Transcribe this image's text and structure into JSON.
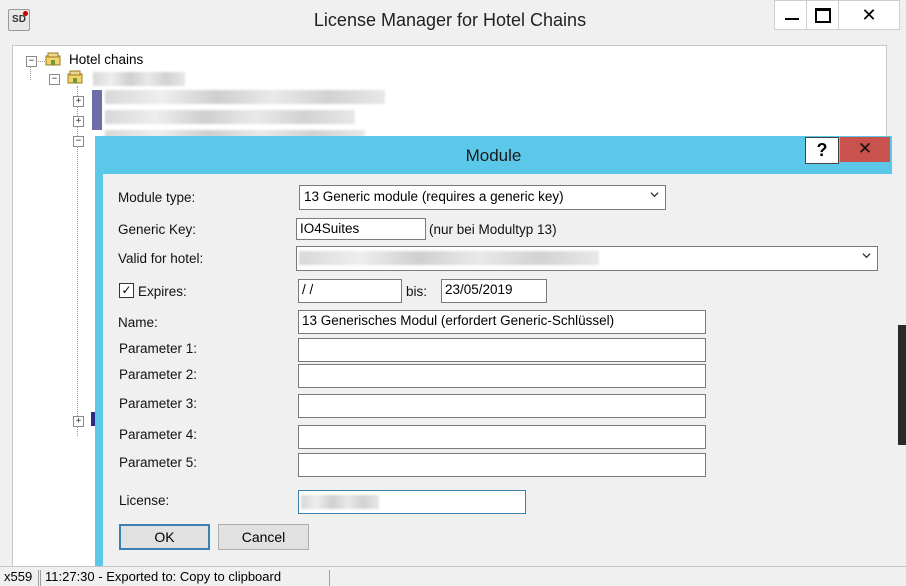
{
  "window": {
    "title": "License Manager for Hotel Chains",
    "app_icon_label": "SD",
    "minimize_glyph": "—",
    "close_glyph": "✕"
  },
  "tree": {
    "root_label": "Hotel chains",
    "expander_collapse": "−",
    "expander_expand": "+"
  },
  "status": {
    "cell1": "x559",
    "cell2": "11:27:30 - Exported to: Copy to clipboard"
  },
  "modal": {
    "title": "Module",
    "help_glyph": "?",
    "close_glyph": "✕",
    "module_type_label": "Module type:",
    "module_type_value": "13 Generic module (requires a generic key)",
    "generic_key_label": "Generic Key:",
    "generic_key_value": "IO4Suites",
    "generic_key_hint": "(nur bei Modultyp 13)",
    "valid_hotel_label": "Valid for hotel:",
    "expires_label": "Expires:",
    "expires_checked": true,
    "expires_from_value": " /  /",
    "bis_label": "bis:",
    "expires_to_value": "23/05/2019",
    "name_label": "Name:",
    "name_value": "13 Generisches Modul (erfordert Generic-Schlüssel)",
    "param1_label": "Parameter 1:",
    "param2_label": "Parameter 2:",
    "param3_label": "Parameter 3:",
    "param4_label": "Parameter 4:",
    "param5_label": "Parameter 5:",
    "license_label": "License:",
    "ok_label": "OK",
    "cancel_label": "Cancel"
  }
}
